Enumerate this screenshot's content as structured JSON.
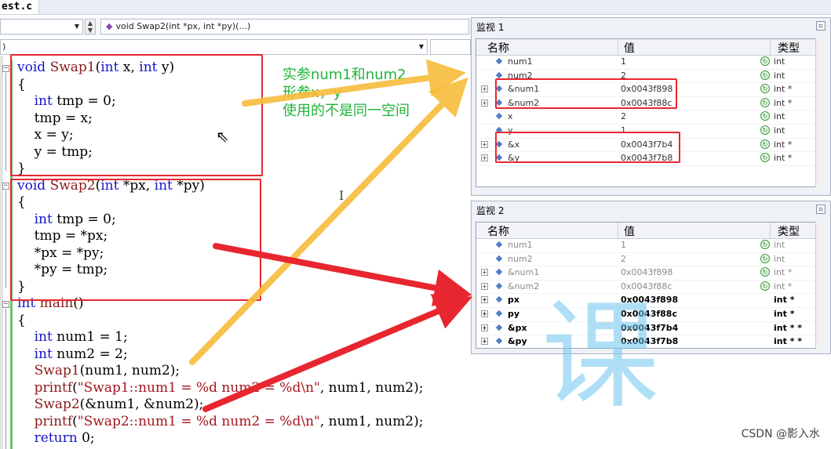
{
  "tab": {
    "file_name": "est.c"
  },
  "nav": {
    "function_combo": "void Swap2(int *px, int *py)(...)",
    "line2_combo": ")"
  },
  "code_lines": [
    "void Swap1(int x, int y)",
    "{",
    "    int tmp = 0;",
    "    tmp = x;",
    "    x = y;",
    "    y = tmp;",
    "}",
    "void Swap2(int *px, int *py)",
    "{",
    "    int tmp = 0;",
    "    tmp = *px;",
    "    *px = *py;",
    "    *py = tmp;",
    "}",
    "int main()",
    "{",
    "    int num1 = 1;",
    "    int num2 = 2;",
    "    Swap1(num1, num2);",
    "    printf(\"Swap1::num1 = %d num2 = %d\\n\", num1, num2);",
    "    Swap2(&num1, &num2);",
    "    printf(\"Swap2::num1 = %d num2 = %d\\n\", num1, num2);",
    "    return 0;"
  ],
  "annotation": {
    "line1": "实参num1和num2",
    "line2": "形参x，y",
    "line3": "使用的不是同一空间",
    "color": "#20b43a"
  },
  "watch1": {
    "title": "监视 1",
    "headers": {
      "name": "名称",
      "value": "值",
      "type": "类型"
    },
    "rows": [
      {
        "name": "num1",
        "value": "1",
        "type": "int",
        "expandable": false
      },
      {
        "name": "num2",
        "value": "2",
        "type": "int",
        "expandable": false
      },
      {
        "name": "&num1",
        "value": "0x0043f898",
        "type": "int *",
        "expandable": true
      },
      {
        "name": "&num2",
        "value": "0x0043f88c",
        "type": "int *",
        "expandable": true
      },
      {
        "name": "x",
        "value": "2",
        "type": "int",
        "expandable": false
      },
      {
        "name": "y",
        "value": "1",
        "type": "int",
        "expandable": false
      },
      {
        "name": "&x",
        "value": "0x0043f7b4",
        "type": "int *",
        "expandable": true
      },
      {
        "name": "&y",
        "value": "0x0043f7b8",
        "type": "int *",
        "expandable": true
      }
    ]
  },
  "watch2": {
    "title": "监视 2",
    "headers": {
      "name": "名称",
      "value": "值",
      "type": "类型"
    },
    "rows": [
      {
        "name": "num1",
        "value": "1",
        "type": "int",
        "expandable": false
      },
      {
        "name": "num2",
        "value": "2",
        "type": "int",
        "expandable": false
      },
      {
        "name": "&num1",
        "value": "0x0043f898",
        "type": "int *",
        "expandable": true
      },
      {
        "name": "&num2",
        "value": "0x0043f88c",
        "type": "int *",
        "expandable": true
      },
      {
        "name": "px",
        "value": "0x0043f898",
        "type": "int *",
        "expandable": true,
        "bold": true
      },
      {
        "name": "py",
        "value": "0x0043f88c",
        "type": "int *",
        "expandable": true,
        "bold": true
      },
      {
        "name": "&px",
        "value": "0x0043f7b4",
        "type": "int * *",
        "expandable": true,
        "bold": true
      },
      {
        "name": "&py",
        "value": "0x0043f7b8",
        "type": "int * *",
        "expandable": true,
        "bold": true
      }
    ]
  },
  "watermark": "CSDN @影入水",
  "background_watermark": "课",
  "colors": {
    "red_box": "#e8262f",
    "arrow_yellow": "#f7bc3a",
    "arrow_red": "#e8262f",
    "keyword": "#1515c8"
  }
}
